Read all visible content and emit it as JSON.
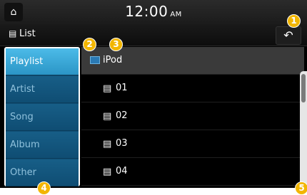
{
  "status": {
    "time": "12:00",
    "ampm": "AM",
    "home_icon": "home-icon"
  },
  "header": {
    "title": "List",
    "back_icon": "back-arrow-icon"
  },
  "menu": {
    "items": [
      {
        "label": "Playlist",
        "active": true
      },
      {
        "label": "Artist",
        "active": false
      },
      {
        "label": "Song",
        "active": false
      },
      {
        "label": "Album",
        "active": false
      },
      {
        "label": "Other",
        "active": false
      }
    ]
  },
  "list": {
    "root": "iPod",
    "items": [
      "01",
      "02",
      "03",
      "04"
    ]
  },
  "callouts": [
    "1",
    "2",
    "3",
    "4",
    "5"
  ],
  "colors": {
    "menu_bg": "#0f4d73",
    "menu_active": "#3aa8d8",
    "badge": "#f2b600"
  }
}
